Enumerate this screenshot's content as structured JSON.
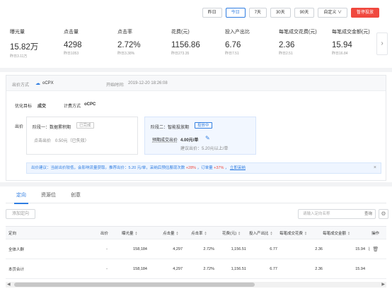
{
  "date_buttons": [
    "昨日",
    "今日",
    "7天",
    "30天",
    "90天",
    "自定义 ∨",
    "暂停投放"
  ],
  "metrics": [
    {
      "label": "曝光量",
      "value": "15.82万",
      "yesterday": "昨日3.11万"
    },
    {
      "label": "点击量",
      "value": "4298",
      "yesterday": "昨日1053"
    },
    {
      "label": "点击率",
      "value": "2.72%",
      "yesterday": "昨日3.38%"
    },
    {
      "label": "花费(元)",
      "value": "1156.86",
      "yesterday": "昨日273.35"
    },
    {
      "label": "投入产出比",
      "value": "6.76",
      "yesterday": "昨日7.51"
    },
    {
      "label": "每笔成交花费(元)",
      "value": "2.36",
      "yesterday": "昨日2.51"
    },
    {
      "label": "每笔成交金额(元)",
      "value": "15.94",
      "yesterday": "昨日16.84"
    }
  ],
  "bid": {
    "mode_label": "出价方式",
    "mode_value": "oCPX",
    "start_label": "开始时间:",
    "start_value": "2019-12-20 18:26:08",
    "goal_label": "优化目标",
    "goal_value": "成交",
    "charge_label": "计费方式",
    "charge_value": "oCPC",
    "bid_label": "出价",
    "stage1_title": "阶段一：数据累积期",
    "stage1_tag": "已完成",
    "stage1_price_label": "点击出价",
    "stage1_price": "0.50元（已失效）",
    "stage2_title": "阶段二：智能投放期",
    "stage2_tag": "投放中",
    "stage2_price_label": "预期成交出价",
    "stage2_price": "4.00元/单",
    "stage2_suggest": "建议出价：5.20元以上/单",
    "notice_a": "出价建议：当前出价较低，会影响流量获取。推荐出价：5.20 元/单，采纳后预估展现次数",
    "notice_b": "+28%",
    "notice_c": "，订单量",
    "notice_d": "+37%",
    "notice_e": "，",
    "notice_f": "立即采纳"
  },
  "tabs": [
    "定向",
    "资源位",
    "创意"
  ],
  "add_button": "添加定向",
  "search_placeholder": "请输入定向名称",
  "search_button": "查询",
  "table": {
    "headers": [
      "定向",
      "出价",
      "曝光量",
      "点击量",
      "点击率",
      "花费(元)",
      "投入产出比",
      "每笔成交花费",
      "每笔成交金额",
      "操作"
    ],
    "rows": [
      [
        "全体人群",
        "-",
        "158,184",
        "4,297",
        "2.72%",
        "1,156.51",
        "6.77",
        "2.36",
        "15.94"
      ],
      [
        "本页合计",
        "-",
        "158,184",
        "4,297",
        "2.72%",
        "1,156.51",
        "6.77",
        "2.36",
        "15.94"
      ]
    ]
  },
  "colors": {
    "accent": "#2f7de1",
    "danger": "#f0483e",
    "positive": "#f0483e"
  }
}
